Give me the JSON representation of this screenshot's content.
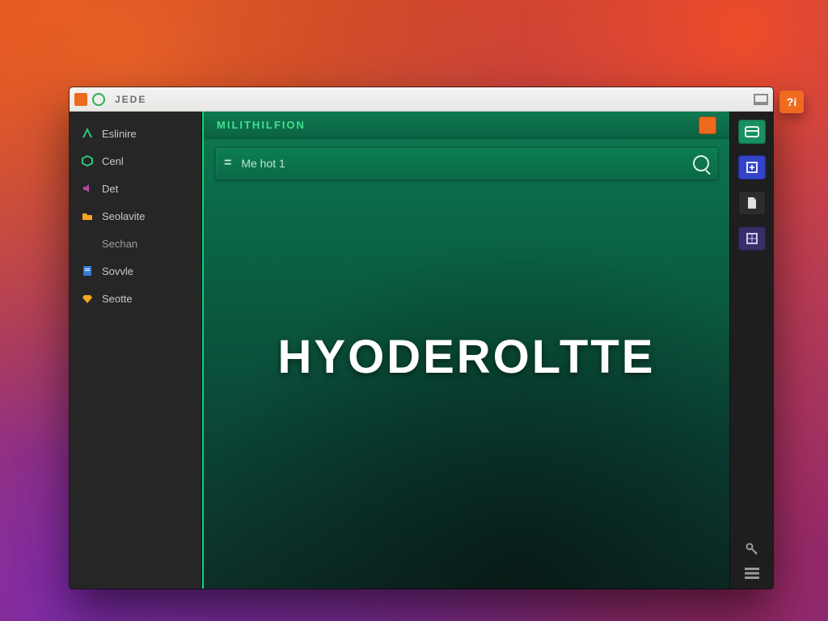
{
  "titlebar": {
    "title": "JEDE"
  },
  "sidebar": {
    "items": [
      {
        "label": "Eslinire"
      },
      {
        "label": "Cenl"
      },
      {
        "label": "Det"
      },
      {
        "label": "Seolavite"
      },
      {
        "label": "Sechan"
      },
      {
        "label": "Sovvle"
      },
      {
        "label": "Seotte"
      }
    ]
  },
  "main": {
    "header_label": "MILITHILFION",
    "search_prefix": "=",
    "search_placeholder": "Me hot 1",
    "hero_text": "HYODEROLTTE"
  },
  "chip": {
    "glyph": "?i"
  }
}
